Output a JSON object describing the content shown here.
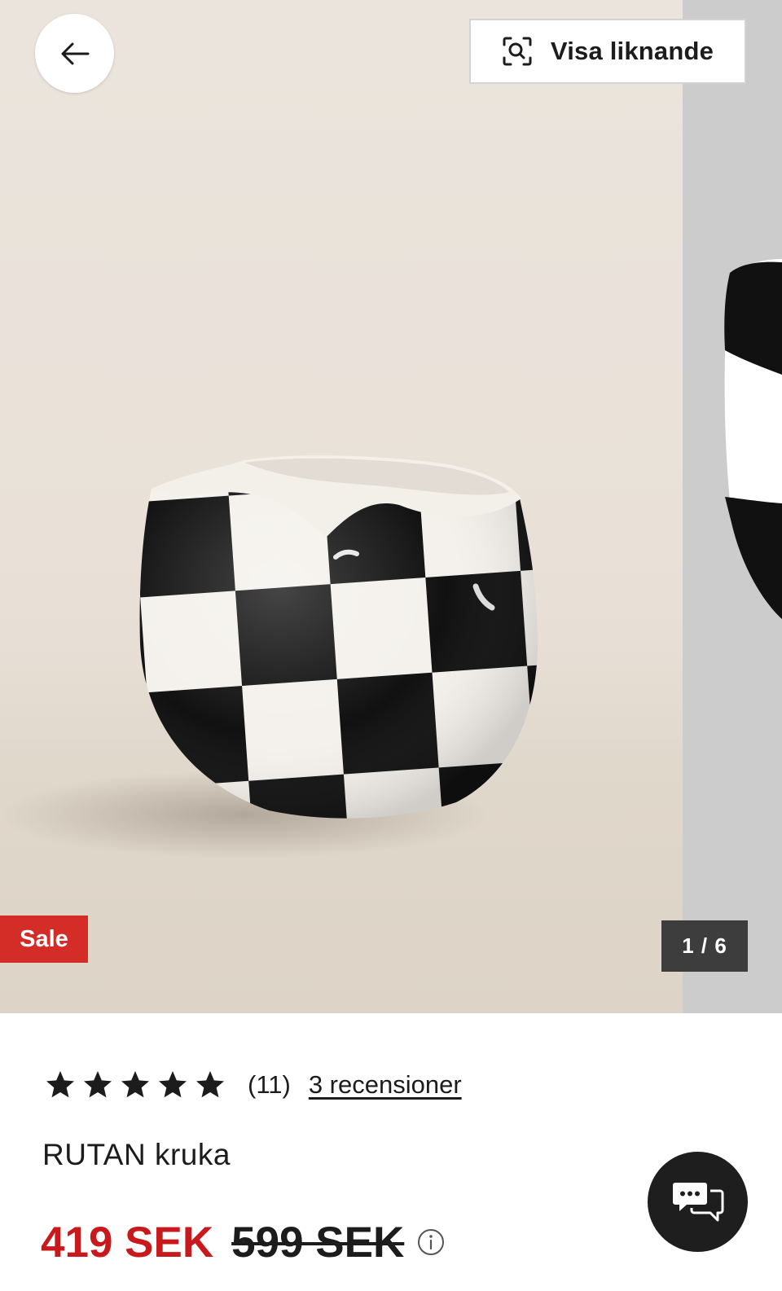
{
  "carousel": {
    "counter": "1 / 6",
    "badge": "Sale",
    "similar_label": "Visa liknande",
    "current_slide": 1,
    "total_slides": 6
  },
  "product": {
    "rating_stars": 5,
    "rating_count": "(11)",
    "reviews_link": "3 recensioner",
    "title": "RUTAN kruka",
    "price_now": "419 SEK",
    "price_old": "599 SEK"
  },
  "icons": {
    "back": "arrow-left-icon",
    "similar": "visual-search-icon",
    "star": "star-icon",
    "info": "info-icon",
    "chat": "chat-bubbles-icon"
  },
  "colors": {
    "sale_red": "#d42c26",
    "price_red": "#c8191c",
    "text": "#1c1c1c",
    "counter_bg": "#3d3d3d",
    "chat_bg": "#1e1e1e"
  }
}
